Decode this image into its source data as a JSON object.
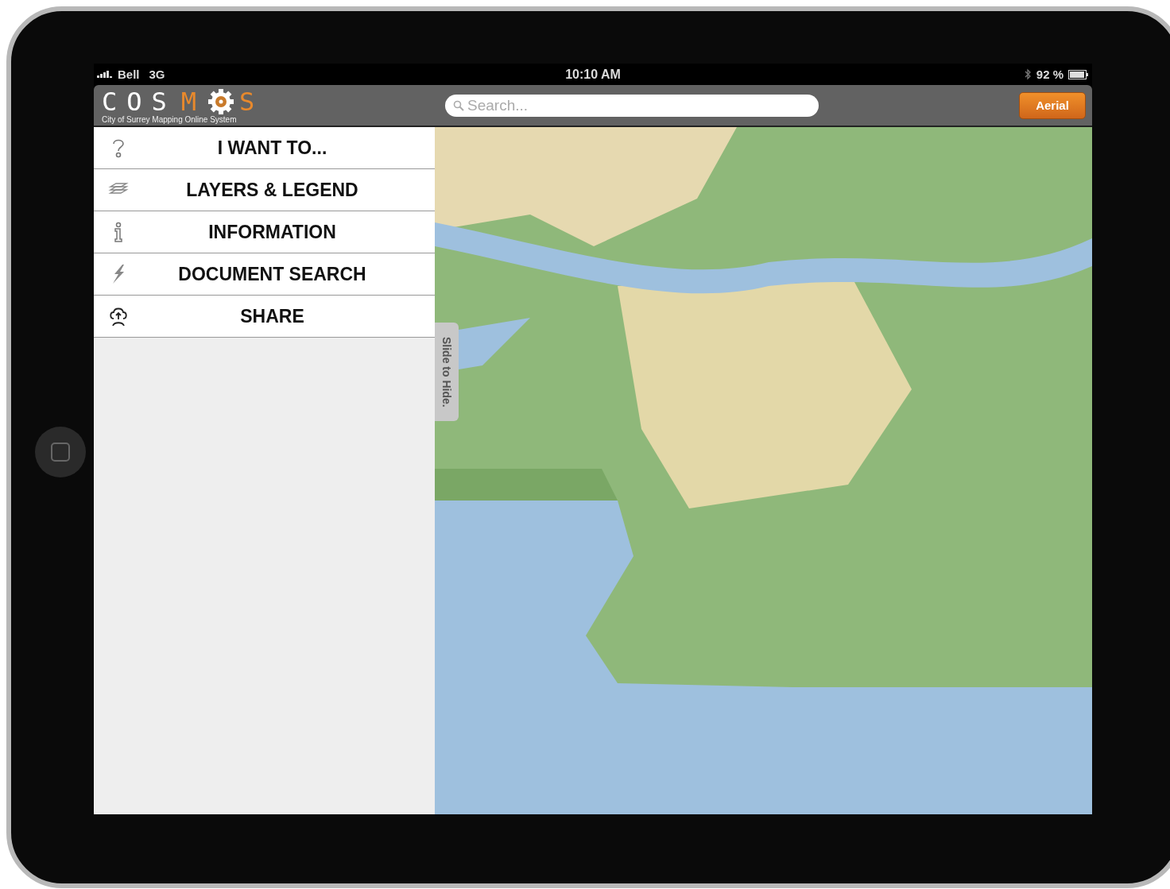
{
  "status_bar": {
    "carrier": "Bell",
    "network": "3G",
    "time": "10:10 AM",
    "battery": "92 %"
  },
  "toolbar": {
    "logo": [
      {
        "text": "COS",
        "kind": "plain"
      },
      {
        "text": "M",
        "kind": "accent"
      },
      {
        "kind": "gear"
      },
      {
        "text": "S",
        "kind": "accent"
      }
    ],
    "logo_subtitle": "City of Surrey Mapping Online System",
    "search": {
      "placeholder": "Search..."
    },
    "aerial_button": "Aerial"
  },
  "menu": [
    {
      "label": "I WANT TO...",
      "kind": "question"
    },
    {
      "label": "LAYERS & LEGEND",
      "kind": "layers"
    },
    {
      "label": "INFORMATION",
      "kind": "info"
    },
    {
      "label": "DOCUMENT SEARCH",
      "kind": "bolt"
    },
    {
      "label": "SHARE",
      "kind": "share"
    }
  ],
  "slide_tab": "Slide to Hide."
}
